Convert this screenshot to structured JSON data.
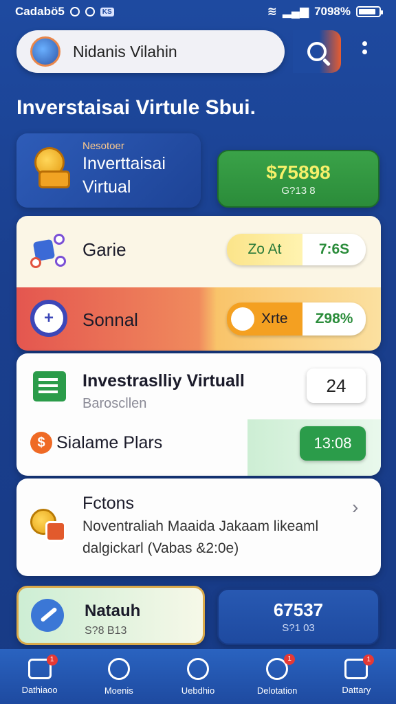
{
  "status_bar": {
    "left_text": "Cadabö5",
    "mini_tag": "KS",
    "right_text": "7098%"
  },
  "search": {
    "value": "Nidanis Vilahin"
  },
  "page_title": "Inverstaisai Virtule Sbui.",
  "virtual_card": {
    "kicker": "Nesotoer",
    "title_line1": "Inverttaisai",
    "title_line2": "Virtual"
  },
  "balance_card": {
    "value": "$75898",
    "sub": "G?13 8"
  },
  "game_row": {
    "label": "Garie",
    "pill_left": "Zo At",
    "pill_right": "7:6S"
  },
  "sonal_row": {
    "label": "Sonnal",
    "pill_left": "Xrte",
    "pill_right": "Z98%"
  },
  "invest_card": {
    "title": "Investraslliy Virtuall",
    "subtitle": "Baroscllen",
    "count": "24",
    "plan_label": "Sialame Plars",
    "time": "13:08"
  },
  "focus_card": {
    "title": "Fctons",
    "line1": "Noventraliah Maaida Jakaam likeaml",
    "line2": "dalgickarl (Vabas &2:0e)"
  },
  "natauh_card": {
    "title": "Natauh",
    "sub": "S?8 B13"
  },
  "stat_card": {
    "value": "67537",
    "sub": "S?1 03"
  },
  "bottom_nav": [
    {
      "label": "Dathiaoo",
      "badge": "1"
    },
    {
      "label": "Moenis",
      "badge": ""
    },
    {
      "label": "Uebdhio",
      "badge": ""
    },
    {
      "label": "Delotation",
      "badge": "1"
    },
    {
      "label": "Dattary",
      "badge": "1"
    }
  ],
  "colors": {
    "primary_blue": "#1e4aa0",
    "accent_green": "#2b9c4a",
    "accent_orange": "#ef6a25",
    "balance_yellow": "#f6f06a"
  },
  "icons": [
    "avatar",
    "search-icon",
    "more-icon",
    "coin-stack-icon",
    "game-icon",
    "chat-icon",
    "chart-icon",
    "dollar-icon",
    "money-icon",
    "pen-icon",
    "home-icon",
    "search-nav-icon",
    "transfer-icon",
    "notification-icon",
    "wallet-icon",
    "chevron-right-icon"
  ]
}
